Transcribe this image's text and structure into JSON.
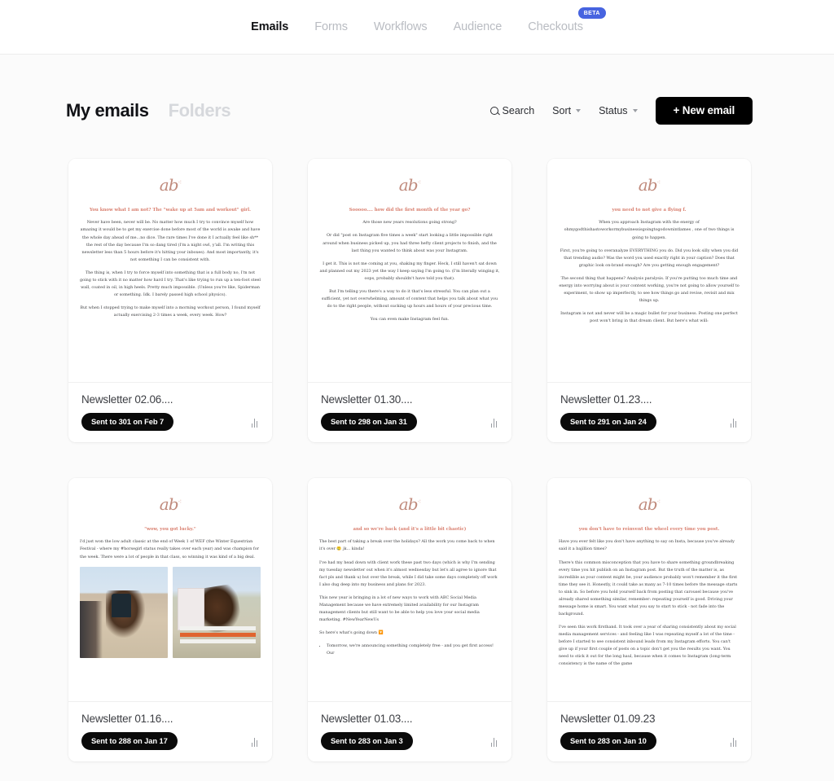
{
  "nav": {
    "items": [
      {
        "label": "Emails",
        "active": true
      },
      {
        "label": "Forms",
        "active": false
      },
      {
        "label": "Workflows",
        "active": false
      },
      {
        "label": "Audience",
        "active": false
      },
      {
        "label": "Checkouts",
        "active": false
      }
    ],
    "beta_badge": "BETA"
  },
  "header": {
    "title": "My emails",
    "folders_tab": "Folders",
    "search_label": "Search",
    "sort_label": "Sort",
    "status_label": "Status",
    "new_email_label": "+ New email"
  },
  "brand": {
    "logo_text": "ab",
    "logo_color": "#c08b7d",
    "accent_heading": "#d98070",
    "highlight": "#e2553c",
    "beta_blue": "#4764e0",
    "pill_black": "#0a0a0a"
  },
  "cards": [
    {
      "title": "Newsletter 02.06....",
      "sent_label": "Sent to 301 on Feb 7",
      "heading": "You know what I am not? The \"wake up at 5am and workout\" girl.",
      "paragraphs": [
        "Never have been, never will be. No matter how much I try to convince myself how amazing it would be to get my exercise done before most of the world is awake and have the whole day ahead of me...no dice. The rare times I've done it I actually feel like sh** the rest of the day because I'm so dang tired (I'm a night owl, y'all. I'm writing this newsletter less than 5 hours before it's hitting your inboxes). And most importantly, it's not something I can be consistent with.",
        "The thing is, when I try to force myself into something that is a full body no, I'm not going to stick with it no matter how hard I try. That's like trying to run up a ten-foot steel wall, coated in oil, in high heels. Pretty much impossible. (Unless you're like, Spiderman or something. Idk. I barely passed high school physics).",
        "But when I stopped trying to make myself into a morning workout person, I found myself actually exercising 2-3 times a week, every week. How?"
      ]
    },
    {
      "title": "Newsletter 01.30....",
      "sent_label": "Sent to 298 on Jan 31",
      "heading": "Sooooo.... how did the first month of the year go?",
      "paragraphs": [
        "Are those new years resolutions going strong?",
        "Or did \"post on Instagram five times a week\" start looking a little impossible right around when business picked up, you had three hefty client projects to finish, and the last thing you wanted to think about was your Instagram.",
        "I get it. This is not me coming at you, shaking my finger. Heck, I still haven't sat down and planned out my 2023 yet the way I keep saying I'm going to. (I'm literally winging it, oops, probably shouldn't have told you that).",
        "But I'm telling you there's a way to do it that's less stressful. You can plan out a sufficient, yet not overwhelming, amount of content that helps you talk about what you do to the right people, without sucking up hours and hours of your precious time.",
        "You can even make Instagram feel fun."
      ]
    },
    {
      "title": "Newsletter 01.23....",
      "sent_label": "Sent to 291 on Jan 24",
      "heading": "you need to not give a flying f.",
      "paragraphs": [
        "When you approach Instagram with the energy of ohmygodthishastoworkormybusinessisgoingtogodownintlames , one of two things is going to happen.",
        "First, you're going to overanalyze EVERYTHING you do. Did you look silly when you did that trending audio? Was the word you used exactly right in your caption? Does that graphic look on-brand enough? Are you getting enough engagement?",
        "The second thing that happens? Analysis paralysis. If you're putting too much time and energy into worrying about is your content working, you're not going to allow yourself to experiment, to show up imperfectly, to see how things go and revise, revisit and mix things up.",
        "Instagram is not and never will be a magic bullet for your business. Posting one perfect post won't bring in that dream client. But here's what will:"
      ]
    },
    {
      "title": "Newsletter 01.16....",
      "sent_label": "Sent to 288 on Jan 17",
      "heading": "\"wow, you got lucky.\"",
      "paragraphs": [
        "I'd just won the low adult classic at the end of Week 1 of WEF (the Winter Equestrian Festival - where my #horsegirl status really takes over each year) and was champion for the week. There were a lot of people in that class, so winning it was kind of a big deal."
      ],
      "has_photos": true,
      "photo_captions": [
        "rider-award-photo",
        "horse-jumping-photo"
      ]
    },
    {
      "title": "Newsletter 01.03....",
      "sent_label": "Sent to 283 on Jan 3",
      "heading": "and so we're back (and it's a little bit chaotic)",
      "paragraphs": [
        "The best part of taking a break over the holidays? All the work you come back to when it's over 🥲 jk... kinda!",
        "I've had my head down with client work these past two days (which is why I'm sending my tuesday newsletter out when it's almost wednesday but let's all agree to ignore that fact pls and thank u) but over the break, while I did take some days completely off work I also dug deep into my business and plans for 2023.",
        "This new year is bringing in a lot of new ways to work with ABC Social Media Management because we have extremely limited availability for our Instagram management clients but still want to be able to help you love your social media marketing. #NewYearNewUs",
        "So here's what's going down 🔽"
      ],
      "list_items": [
        "Tomorrow, we're announcing something completely free - and you get first access! Our"
      ]
    },
    {
      "title": "Newsletter 01.09.23",
      "sent_label": "Sent to 283 on Jan 10",
      "heading": "you don't have to reinvent the wheel every time you post.",
      "paragraphs": [
        "Have you ever felt like you don't have anything to say on Insta, because you've already said it a bajillion times?",
        "There's this common misconception that you have to share something groundbreaking every time you hit publish on an Instagram post. But the truth of the matter is, as incredible as your content might be, your audience probably won't remember it the first time they see it. Honestly, it could take as many as 7-10 times before the message starts to sink in. So before you hold yourself back from posting that carousel because you've already shared something similar, remember: repeating yourself is good. Driving your message home is smart. You want what you say to start to stick - not fade into the background.",
        "I've seen this work firsthand. It took over a year of sharing consistently about my social media management services - and feeling like I was repeating myself a lot of the time - before I started to see consistent inbound leads from my Instagram efforts. You can't give up if your first couple of posts on a topic don't get you the results you want. You need to stick it out for the long haul, because when it comes to Instagram (long-term consistency is the name of the game"
      ]
    }
  ]
}
